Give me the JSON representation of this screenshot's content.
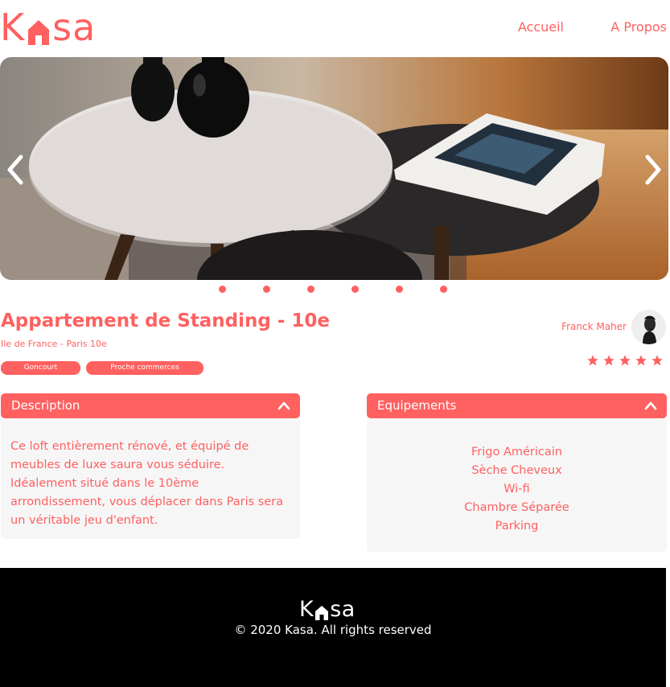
{
  "brand": {
    "logo_left": "K",
    "logo_right": "sa",
    "accent_color": "#FF6060"
  },
  "nav": {
    "home": "Accueil",
    "about": "A Propos"
  },
  "carousel": {
    "prev_icon": "chevron-left-icon",
    "next_icon": "chevron-right-icon",
    "slide_count": 6
  },
  "listing": {
    "title": "Appartement de Standing - 10e",
    "location": "Ile de France - Paris 10e",
    "tags": [
      "Goncourt",
      "Proche commerces"
    ],
    "host": {
      "name": "Franck Maher"
    },
    "rating": 5,
    "rating_max": 5
  },
  "description": {
    "title": "Description",
    "text": "Ce loft entièrement rénové, et équipé de meubles de luxe saura vous séduire. Idéalement situé dans le 10ème arrondissement, vous déplacer dans Paris sera un véritable jeu d'enfant."
  },
  "equipments": {
    "title": "Equipements",
    "items": [
      "Frigo Américain",
      "Sèche Cheveux",
      "Wi-fi",
      "Chambre Séparée",
      "Parking"
    ]
  },
  "footer": {
    "logo_left": "K",
    "logo_right": "sa",
    "copyright": "© 2020 Kasa. All rights reserved"
  }
}
